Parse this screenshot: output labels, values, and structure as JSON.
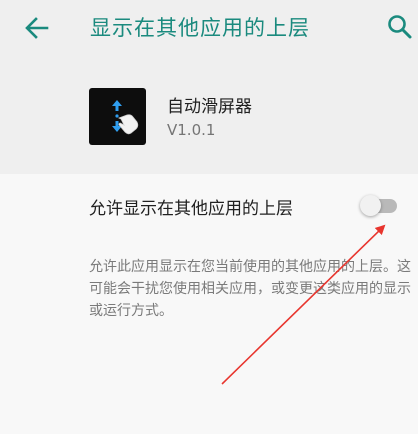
{
  "toolbar": {
    "back_icon": "arrow-back-icon",
    "title": "显示在其他应用的上层",
    "search_icon": "search-icon"
  },
  "app": {
    "name": "自动滑屏器",
    "version": "V1.0.1",
    "icon": "swipe-gesture-icon"
  },
  "setting": {
    "label": "允许显示在其他应用的上层",
    "enabled": false
  },
  "description": "允许此应用显示在您当前使用的其他应用的上层。这可能会干扰您使用相关应用，或变更这类应用的显示或运行方式。",
  "colors": {
    "accent": "#1a8a7e",
    "annotation_arrow": "#e8352e",
    "toggle_off_track": "#b9b9b9"
  }
}
